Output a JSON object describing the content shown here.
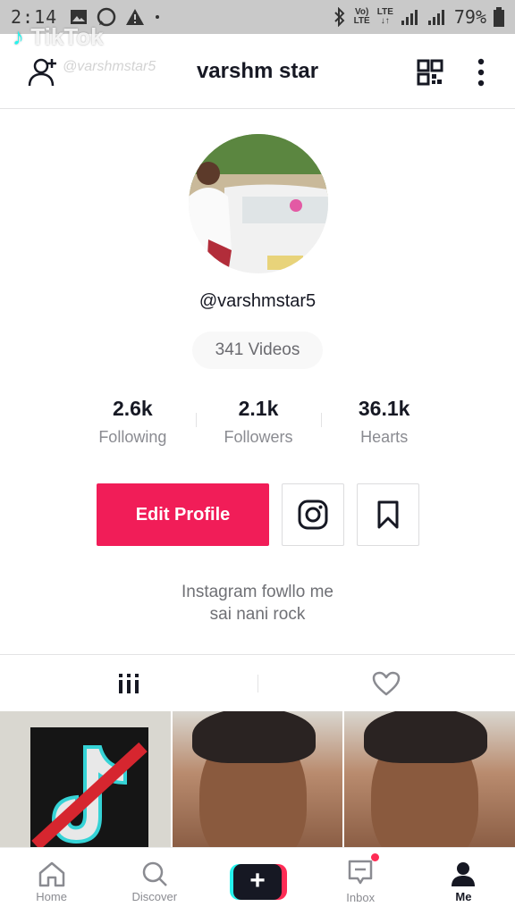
{
  "status_bar": {
    "time": "2:14",
    "network_top": "Vo)",
    "network_bottom": "LTE",
    "lte_top": "LTE",
    "battery": "79%"
  },
  "watermark": {
    "brand": "TikTok",
    "handle": "@varshmstar5"
  },
  "header": {
    "title": "varshm star"
  },
  "profile": {
    "username": "@varshmstar5",
    "videos_label": "341 Videos",
    "stats": [
      {
        "value": "2.6k",
        "label": "Following"
      },
      {
        "value": "2.1k",
        "label": "Followers"
      },
      {
        "value": "36.1k",
        "label": "Hearts"
      }
    ],
    "edit_button": "Edit Profile",
    "bio_line1": "Instagram fowllo me",
    "bio_line2": "sai nani rock"
  },
  "bottom_nav": {
    "items": [
      {
        "label": "Home",
        "icon": "home-icon"
      },
      {
        "label": "Discover",
        "icon": "search-icon"
      },
      {
        "label": "",
        "icon": "plus-icon"
      },
      {
        "label": "Inbox",
        "icon": "inbox-icon"
      },
      {
        "label": "Me",
        "icon": "person-icon"
      }
    ]
  },
  "colors": {
    "accent": "#f11d58",
    "text": "#161823",
    "muted": "#8a8b91"
  }
}
